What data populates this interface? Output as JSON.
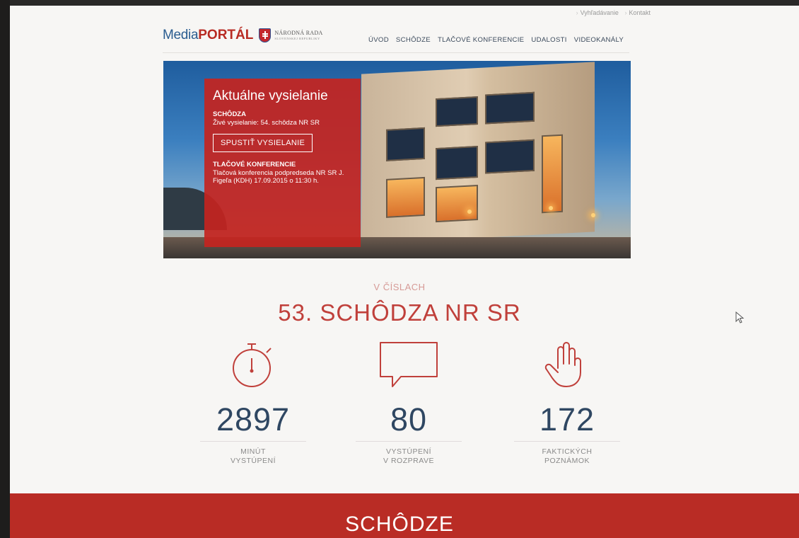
{
  "header": {
    "toplinks": [
      "Vyhľadávanie",
      "Kontakt"
    ],
    "logo": {
      "media": "Media",
      "portal": "PORTÁL",
      "nr_line1": "NÁRODNÁ RADA",
      "nr_line2": "SLOVENSKEJ REPUBLIKY"
    },
    "nav": [
      "ÚVOD",
      "SCHÔDZE",
      "TLAČOVÉ KONFERENCIE",
      "UDALOSTI",
      "VIDEOKANÁLY"
    ]
  },
  "hero": {
    "title": "Aktuálne vysielanie",
    "session_heading": "SCHÔDZA",
    "session_text": "Živé vysielanie: 54. schôdza NR SR",
    "button": "SPUSTIŤ VYSIELANIE",
    "press_heading": "TLAČOVÉ KONFERENCIE",
    "press_text": "Tlačová konferencia podpredseda NR SR J. Figeľa (KDH) 17.09.2015 o 11:30 h."
  },
  "stats": {
    "kicker": "V ČÍSLACH",
    "title": "53. SCHÔDZA NR SR",
    "items": [
      {
        "icon": "stopwatch-icon",
        "value": "2897",
        "label1": "MINÚT",
        "label2": "VYSTÚPENÍ"
      },
      {
        "icon": "speech-bubble-icon",
        "value": "80",
        "label1": "VYSTÚPENÍ",
        "label2": "V ROZPRAVE"
      },
      {
        "icon": "raised-hand-icon",
        "value": "172",
        "label1": "FAKTICKÝCH",
        "label2": "POZNÁMOK"
      }
    ]
  },
  "footer": {
    "title": "SCHÔDZE"
  },
  "colors": {
    "brand_red": "#c4241f",
    "brand_blue": "#2a5c8f",
    "number_blue": "#2f4762"
  }
}
